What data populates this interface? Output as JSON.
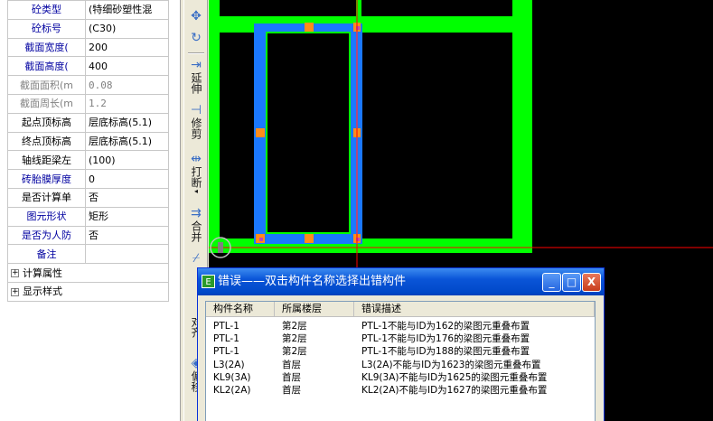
{
  "properties": [
    {
      "label": "砼类型",
      "value": "(特细砂塑性混",
      "style": "blue"
    },
    {
      "label": "砼标号",
      "value": "(C30)",
      "style": "blue"
    },
    {
      "label": "截面宽度(",
      "value": "200",
      "style": "blue"
    },
    {
      "label": "截面高度(",
      "value": "400",
      "style": "blue"
    },
    {
      "label": "截面面积(m",
      "value": "0.08",
      "style": "gray"
    },
    {
      "label": "截面周长(m",
      "value": "1.2",
      "style": "gray"
    },
    {
      "label": "起点顶标高",
      "value": "层底标高(5.1)",
      "style": "black"
    },
    {
      "label": "终点顶标高",
      "value": "层底标高(5.1)",
      "style": "black"
    },
    {
      "label": "轴线距梁左",
      "value": "(100)",
      "style": "black"
    },
    {
      "label": "砖胎膜厚度",
      "value": "0",
      "style": "blue"
    },
    {
      "label": "是否计算单",
      "value": "否",
      "style": "black"
    },
    {
      "label": "图元形状",
      "value": "矩形",
      "style": "blue"
    },
    {
      "label": "是否为人防",
      "value": "否",
      "style": "blue"
    },
    {
      "label": "备注",
      "value": "",
      "style": "blue"
    }
  ],
  "property_groups": [
    {
      "label": "计算属性",
      "toggle": "+"
    },
    {
      "label": "显示样式",
      "toggle": "+"
    }
  ],
  "toolbar": {
    "extend": "延伸",
    "trim": "修剪",
    "break": "打断",
    "merge": "合并",
    "bottom_partial": "对齐",
    "bottom_partial2": "偏移"
  },
  "dialog": {
    "title": "错误——双击构件名称选择出错构件",
    "app_icon": "E",
    "min_glyph": "_",
    "max_glyph": "□",
    "close_glyph": "X",
    "columns": [
      "构件名称",
      "所属楼层",
      "错误描述"
    ],
    "rows": [
      [
        "PTL-1",
        "第2层",
        "PTL-1不能与ID为162的梁图元重叠布置"
      ],
      [
        "PTL-1",
        "第2层",
        "PTL-1不能与ID为176的梁图元重叠布置"
      ],
      [
        "PTL-1",
        "第2层",
        "PTL-1不能与ID为188的梁图元重叠布置"
      ],
      [
        "L3(2A)",
        "首层",
        "L3(2A)不能与ID为1623的梁图元重叠布置"
      ],
      [
        "KL9(3A)",
        "首层",
        "KL9(3A)不能与ID为1625的梁图元重叠布置"
      ],
      [
        "KL2(2A)",
        "首层",
        "KL2(2A)不能与ID为1627的梁图元重叠布置"
      ]
    ]
  },
  "colors": {
    "beam_green": "#00ff00",
    "beam_blue": "#1a78ff",
    "node_orange": "#ff8c1a",
    "crosshair_red": "#ff0000"
  }
}
